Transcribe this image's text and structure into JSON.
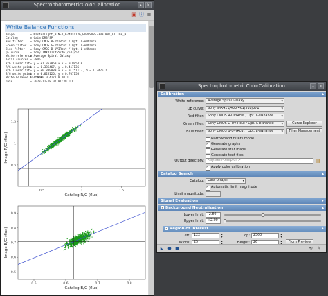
{
  "left_window": {
    "title": "SpectrophotometricColorCalibration",
    "tool_icons": [
      "pdf-icon",
      "info-icon",
      "menu-icon"
    ],
    "heading": "White Balance Functions",
    "info_rows": [
      {
        "k": "Image",
        "v": "= MasterLight_BIN-1_6248x4176_EXPOSURE-300.00s_FILTER_N..."
      },
      {
        "k": "Catalog",
        "v": "= Gaia DR3/SP"
      },
      {
        "k": "Red filter",
        "v": "= Sony CMOS R-UVIRcut / Opt. L-eNhance"
      },
      {
        "k": "Green filter",
        "v": "= Sony CMOS G-UVIRcut / Opt. L-eNhance"
      },
      {
        "k": "Blue filter",
        "v": "= Sony CMOS B-UVIRcut / Opt. L-eNhance"
      },
      {
        "k": "QE curve",
        "v": "= Sony IMX411/455/461/533/571"
      },
      {
        "k": "White reference",
        "v": "= Average Spiral Galaxy"
      },
      {
        "k": "Total sources",
        "v": "= 3845"
      },
      {
        "k": "R/G linear fit",
        "v": "= y = +1.357050 × x + 0.095418"
      },
      {
        "k": "R/G white point",
        "v": "= x = 0.335467, y = 0.417136"
      },
      {
        "k": "B/G linear fit",
        "v": "= y = +0.889089 × x + 0.151117, σ = 1.342612"
      },
      {
        "k": "B/G white point",
        "v": "= x = 0.625126, y = 0.707158"
      },
      {
        "k": "White balance factors",
        "v": "= 1.0000 0.4171 0.7071"
      },
      {
        "k": "Date",
        "v": "= 2023-11-18 02:01:39 UTC"
      }
    ],
    "charts": [
      {
        "ylabel": "Image R/G (flux)",
        "xlabel": "Catalog R/G (flux)",
        "xticks": [
          "0.5",
          "1",
          "1.5"
        ],
        "yticks": [
          "0.5",
          "1",
          "1.5"
        ]
      },
      {
        "ylabel": "Image B/G (flux)",
        "xlabel": "Catalog B/G (flux)",
        "xticks": [
          "0.5",
          "0.6",
          "0.7",
          "0.8"
        ],
        "yticks": [
          "0.5",
          "0.6",
          "0.7",
          "0.8",
          "0.9"
        ]
      }
    ]
  },
  "chart_data": [
    {
      "type": "scatter",
      "xlabel": "Catalog R/G (flux)",
      "ylabel": "Image R/G (flux)",
      "xlim": [
        0.2,
        1.8
      ],
      "ylim": [
        0.0,
        1.8
      ],
      "fit_line": {
        "slope": 1.35705,
        "intercept": 0.095418
      },
      "white_point": {
        "x": 0.335467,
        "y": 0.417136
      },
      "colors": {
        "points": "#1a9a1a",
        "fit": "#3b4fcf",
        "crosshair": "#222222"
      }
    },
    {
      "type": "scatter",
      "xlabel": "Catalog B/G (flux)",
      "ylabel": "Image B/G (flux)",
      "xlim": [
        0.45,
        0.85
      ],
      "ylim": [
        0.45,
        0.95
      ],
      "fit_line": {
        "slope": 0.889089,
        "intercept": 0.151117
      },
      "white_point": {
        "x": 0.625126,
        "y": 0.707158
      },
      "colors": {
        "points": "#1a9a1a",
        "fit": "#3b4fcf",
        "crosshair": "#222222"
      }
    }
  ],
  "right_window": {
    "title": "SpectrophotometricColorCalibration",
    "calibration": {
      "header": "Calibration",
      "white_reference_label": "White reference:",
      "white_reference_value": "Average Spiral Galaxy",
      "qe_curve_label": "QE curve:",
      "qe_curve_value": "Sony IMX411/455/461/533/571",
      "red_filter_label": "Red filter:",
      "red_filter_value": "Sony CMOS R-UVIRcut / Opt. L-eNhance",
      "green_filter_label": "Green filter:",
      "green_filter_value": "Sony CMOS G-UVIRcut / Opt. L-eNhance",
      "blue_filter_label": "Blue filter:",
      "blue_filter_value": "Sony CMOS B-UVIRcut / Opt. L-eNhance",
      "curve_explorer_label": "Curve Explorer",
      "filter_management_label": "Filter Management",
      "narrowband_label": "Narrowband filters mode",
      "gen_graphs_label": "Generate graphs",
      "gen_star_maps_label": "Generate star maps",
      "gen_text_files_label": "Generate text files",
      "output_dir_label": "Output directory:",
      "output_dir_placeholder": "<system-temp-dir>",
      "apply_label": "Apply color calibration"
    },
    "catalog_search": {
      "header": "Catalog Search",
      "catalog_label": "Catalog:",
      "catalog_value": "Gaia DR3/SP",
      "auto_limit_label": "Automatic limit magnitude",
      "limit_mag_label": "Limit magnitude:"
    },
    "signal_eval": {
      "header": "Signal Evaluation"
    },
    "background": {
      "header": "Background Neutralization",
      "lower_label": "Lower limit:",
      "lower_value": "-2.80",
      "upper_label": "Upper limit:",
      "upper_value": "+2.00",
      "lower_fraction": 0.4,
      "upper_fraction": 0.01
    },
    "roi": {
      "header": "Region of Interest",
      "left_label": "Left:",
      "left_value": "122",
      "top_label": "Top:",
      "top_value": "2560",
      "width_label": "Width:",
      "width_value": "25",
      "height_label": "Height:",
      "height_value": "26",
      "from_preview_label": "From Preview"
    }
  }
}
